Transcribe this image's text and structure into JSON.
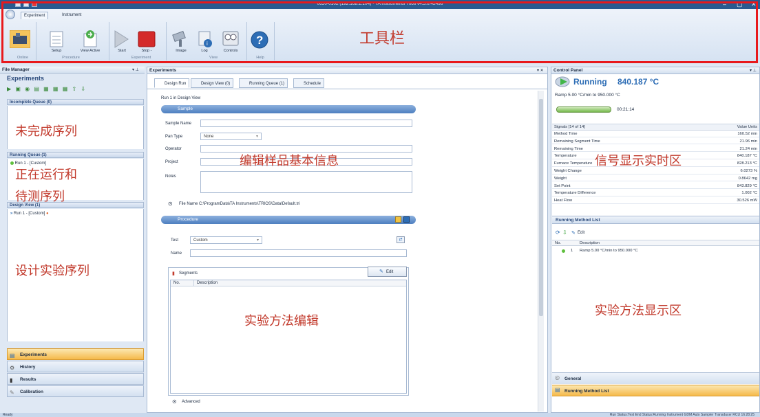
{
  "window": {
    "title": "0650-0102 (192.168.1.104) · TA Instruments Trios v4.5.0.42498"
  },
  "ribbon": {
    "tabs": [
      "Experiment",
      "Instrument"
    ],
    "buttons": {
      "online": "Online",
      "setup": "Setup",
      "view_active": "View Active",
      "start": "Start",
      "stop": "Stop -",
      "image": "Image",
      "log": "Log",
      "controls": "Controls"
    },
    "groups": {
      "procedure": "Procedure",
      "experiment": "Experiment",
      "view": "View",
      "help": "Help"
    }
  },
  "file_manager": {
    "title": "File Manager",
    "experiments_label": "Experiments",
    "incomplete_queue": "Incomplete Queue (0)",
    "running_queue": "Running Queue (1)",
    "running_item": "Run 1 - [Custom]",
    "design_view": "Design View (1)",
    "design_item": "Run 1 - [Custom]",
    "nav": [
      "Experiments",
      "History",
      "Results",
      "Calibration"
    ]
  },
  "center": {
    "panel_title": "Experiments",
    "tabs": [
      "Design Run",
      "Design View (0)",
      "Running Queue (1)",
      "Schedule"
    ],
    "run_caption": "Run 1 in Design View",
    "sample": {
      "header": "Sample",
      "sample_name_label": "Sample Name",
      "pan_type_label": "Pan Type",
      "pan_type_value": "None",
      "operator_label": "Operator",
      "project_label": "Project",
      "notes_label": "Notes",
      "file_name": "File Name  C:\\ProgramData\\TA Instruments\\TRIOS\\Data\\Default.tri"
    },
    "procedure": {
      "header": "Procedure",
      "test_label": "Test",
      "test_value": "Custom",
      "name_label": "Name",
      "segments_tab": "Segments",
      "edit_label": "Edit",
      "col_no": "No.",
      "col_desc": "Description",
      "advanced": "Advanced"
    }
  },
  "control_panel": {
    "title": "Control Panel",
    "status": "Running",
    "temperature": "840.187 °C",
    "ramp": "Ramp 5.00 °C/min to 950.000 °C",
    "elapsed": "00:21:14",
    "signals_header": "Signals [14 of 14]",
    "value_units": "Value  Units",
    "signals": [
      {
        "name": "Method Time",
        "value": "160.52 min"
      },
      {
        "name": "Remaining Segment Time",
        "value": "21.96 min"
      },
      {
        "name": "Remaining Time",
        "value": "21.24 min"
      },
      {
        "name": "Temperature",
        "value": "840.187 °C"
      },
      {
        "name": "Furnace Temperature",
        "value": "828.213 °C"
      },
      {
        "name": "Weight Change",
        "value": "6.0273 %"
      },
      {
        "name": "Weight",
        "value": "0.8642 mg"
      },
      {
        "name": "Set Point",
        "value": "843.829 °C"
      },
      {
        "name": "Temperature Difference",
        "value": "1.002 °C"
      },
      {
        "name": "Heat Flow",
        "value": "30.526 mW"
      }
    ],
    "method_list_title": "Running Method List",
    "method_edit": "Edit",
    "method_cols": {
      "no": "No.",
      "desc": "Description"
    },
    "method_row": {
      "no": "1",
      "desc": "Ramp 5.00 °C/min to 950.000 °C"
    },
    "bottom_general": "General",
    "bottom_method": "Running Method List"
  },
  "annotations": {
    "toolbar": "工具栏",
    "incomplete": "未完成序列",
    "running_line1": "正在运行和",
    "running_line2": "待测序列",
    "design": "设计实验序列",
    "sample_edit": "编辑样品基本信息",
    "signals": "信号显示实时区",
    "method_edit": "实验方法编辑",
    "method_display": "实验方法显示区"
  },
  "statusbar": {
    "left": "Ready",
    "items": "Run Status:Test    End Status:Running    Instrument    GDM    Auto Sampler    Transducer    RCU    16:28:25"
  }
}
